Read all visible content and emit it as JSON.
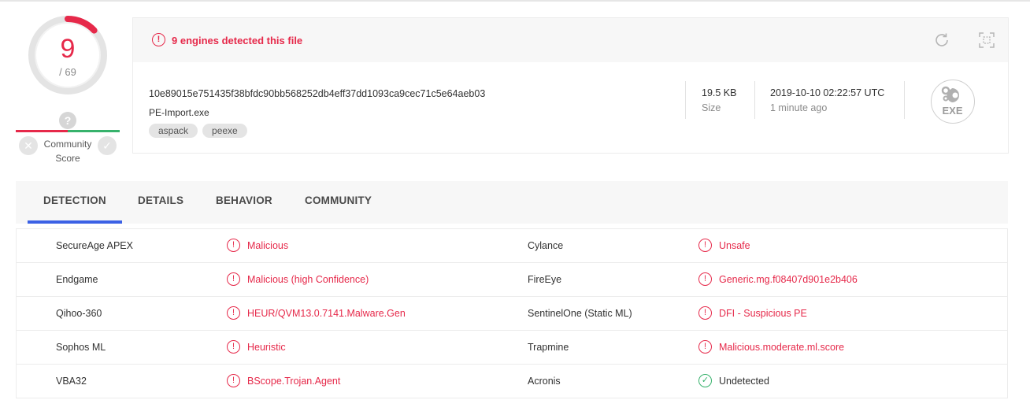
{
  "score": {
    "detections": "9",
    "total": "/ 69",
    "detections_count": 9,
    "total_count": 69,
    "accent_color": "#e6294a"
  },
  "community": {
    "question_mark": "?",
    "label": "Community Score",
    "harmless_glyph": "✕",
    "malicious_glyph": "✓"
  },
  "alert": {
    "icon": "!",
    "text": "9 engines detected this file"
  },
  "file": {
    "hash": "10e89015e751435f38bfdc90bb568252db4eff37dd1093ca9cec71c5e64aeb03",
    "name": "PE-Import.exe",
    "tags": [
      "aspack",
      "peexe"
    ],
    "size_value": "19.5 KB",
    "size_label": "Size",
    "date_value": "2019-10-10 02:22:57 UTC",
    "date_relative": "1 minute ago",
    "type_badge": "EXE"
  },
  "tabs": [
    {
      "label": "DETECTION",
      "active": true
    },
    {
      "label": "DETAILS",
      "active": false
    },
    {
      "label": "BEHAVIOR",
      "active": false
    },
    {
      "label": "COMMUNITY",
      "active": false
    }
  ],
  "detections": [
    {
      "left_engine": "SecureAge APEX",
      "left_result": "Malicious",
      "left_status": "malicious",
      "right_engine": "Cylance",
      "right_result": "Unsafe",
      "right_status": "malicious"
    },
    {
      "left_engine": "Endgame",
      "left_result": "Malicious (high Confidence)",
      "left_status": "malicious",
      "right_engine": "FireEye",
      "right_result": "Generic.mg.f08407d901e2b406",
      "right_status": "malicious"
    },
    {
      "left_engine": "Qihoo-360",
      "left_result": "HEUR/QVM13.0.7141.Malware.Gen",
      "left_status": "malicious",
      "right_engine": "SentinelOne (Static ML)",
      "right_result": "DFI - Suspicious PE",
      "right_status": "malicious"
    },
    {
      "left_engine": "Sophos ML",
      "left_result": "Heuristic",
      "left_status": "malicious",
      "right_engine": "Trapmine",
      "right_result": "Malicious.moderate.ml.score",
      "right_status": "malicious"
    },
    {
      "left_engine": "VBA32",
      "left_result": "BScope.Trojan.Agent",
      "left_status": "malicious",
      "right_engine": "Acronis",
      "right_result": "Undetected",
      "right_status": "undetected"
    }
  ],
  "icons": {
    "malicious": "!",
    "undetected": "✓"
  },
  "colors": {
    "malicious": "#e6294a",
    "clean": "#37b26c",
    "tab_active": "#3b61e5"
  }
}
